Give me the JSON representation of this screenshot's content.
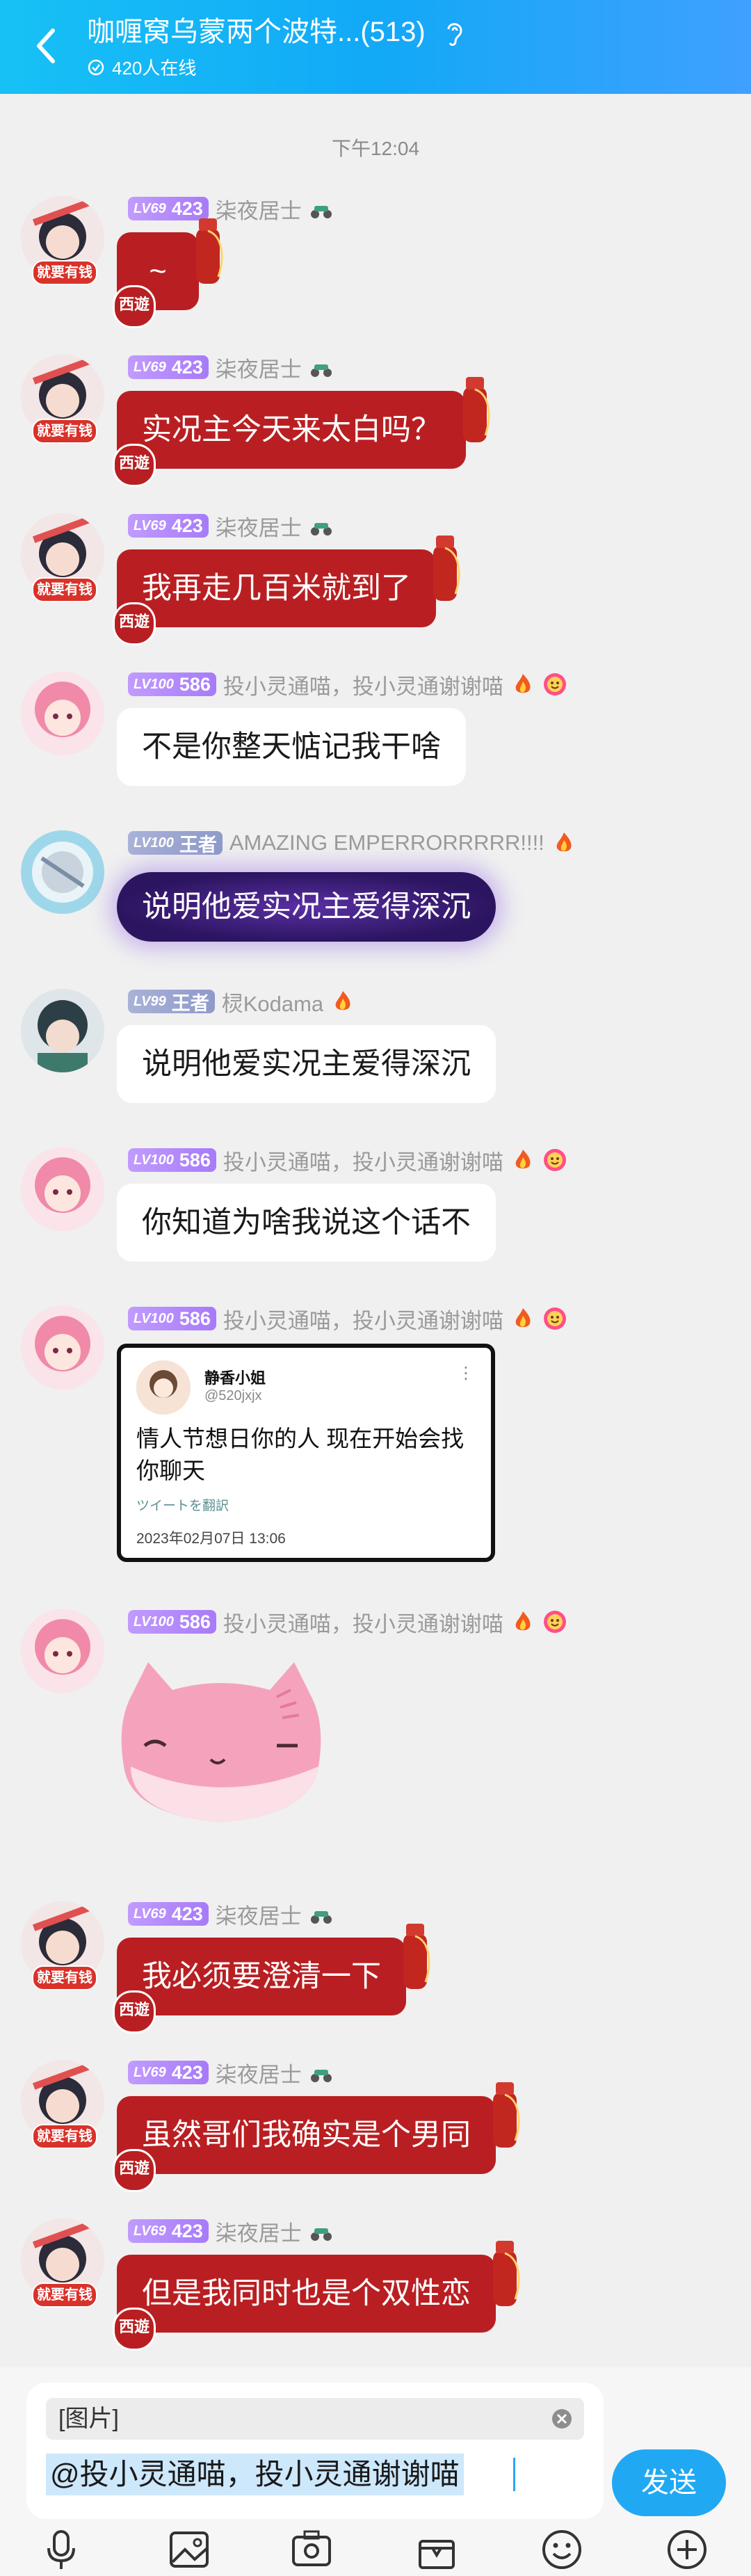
{
  "header": {
    "title": "咖喱窝乌蒙两个波特...(513)",
    "online": "420人在线"
  },
  "time_separator": "下午12:04",
  "messages": [
    {
      "level": "LV69",
      "points": "423",
      "name": "柒夜居士",
      "text": "~",
      "style": "red"
    },
    {
      "level": "LV69",
      "points": "423",
      "name": "柒夜居士",
      "text": "实况主今天来太白吗？",
      "style": "red"
    },
    {
      "level": "LV69",
      "points": "423",
      "name": "柒夜居士",
      "text": "我再走几百米就到了",
      "style": "red"
    },
    {
      "level": "LV100",
      "points": "586",
      "name": "投小灵通喵，投小灵通谢谢喵",
      "text": "不是你整天惦记我干啥",
      "style": "white"
    },
    {
      "level": "LV100",
      "points": "王者",
      "name": "AMAZING EMPERRORRRRR!!!!",
      "text": "说明他爱实况主爱得深沉",
      "style": "purple"
    },
    {
      "level": "LV99",
      "points": "王者",
      "name": "棂Kodama",
      "text": "说明他爱实况主爱得深沉",
      "style": "white"
    },
    {
      "level": "LV100",
      "points": "586",
      "name": "投小灵通喵，投小灵通谢谢喵",
      "text": "你知道为啥我说这个话不",
      "style": "white"
    },
    {
      "level": "LV100",
      "points": "586",
      "name": "投小灵通喵，投小灵通谢谢喵",
      "style": "card"
    },
    {
      "level": "LV100",
      "points": "586",
      "name": "投小灵通喵，投小灵通谢谢喵",
      "style": "sticker"
    },
    {
      "level": "LV69",
      "points": "423",
      "name": "柒夜居士",
      "text": "我必须要澄清一下",
      "style": "red"
    },
    {
      "level": "LV69",
      "points": "423",
      "name": "柒夜居士",
      "text": "虽然哥们我确实是个男同",
      "style": "red"
    },
    {
      "level": "LV69",
      "points": "423",
      "name": "柒夜居士",
      "text": "但是我同时也是个双性恋",
      "style": "red"
    }
  ],
  "tweet_card": {
    "name": "静香小姐",
    "handle": "@520jxjx",
    "more": "⋮",
    "text": "情人节想日你的人 现在开始会找你聊天",
    "translate": "ツイートを翻訳",
    "date": "2023年02月07日 13:06"
  },
  "tags": {
    "rich": "就要有钱",
    "red_bubble_tag": "西遊"
  },
  "composer": {
    "quote": "[图片]",
    "draft": "@投小灵通喵，投小灵通谢谢喵",
    "send": "发送"
  },
  "colors": {
    "header": "#17c1f5",
    "red_bubble": "#b91f22",
    "send": "#20a8f3"
  },
  "icons": [
    "back-icon",
    "ear-icon",
    "online-icon",
    "mic-icon",
    "image-icon",
    "camera-icon",
    "gift-icon",
    "emoji-icon",
    "plus-icon"
  ]
}
